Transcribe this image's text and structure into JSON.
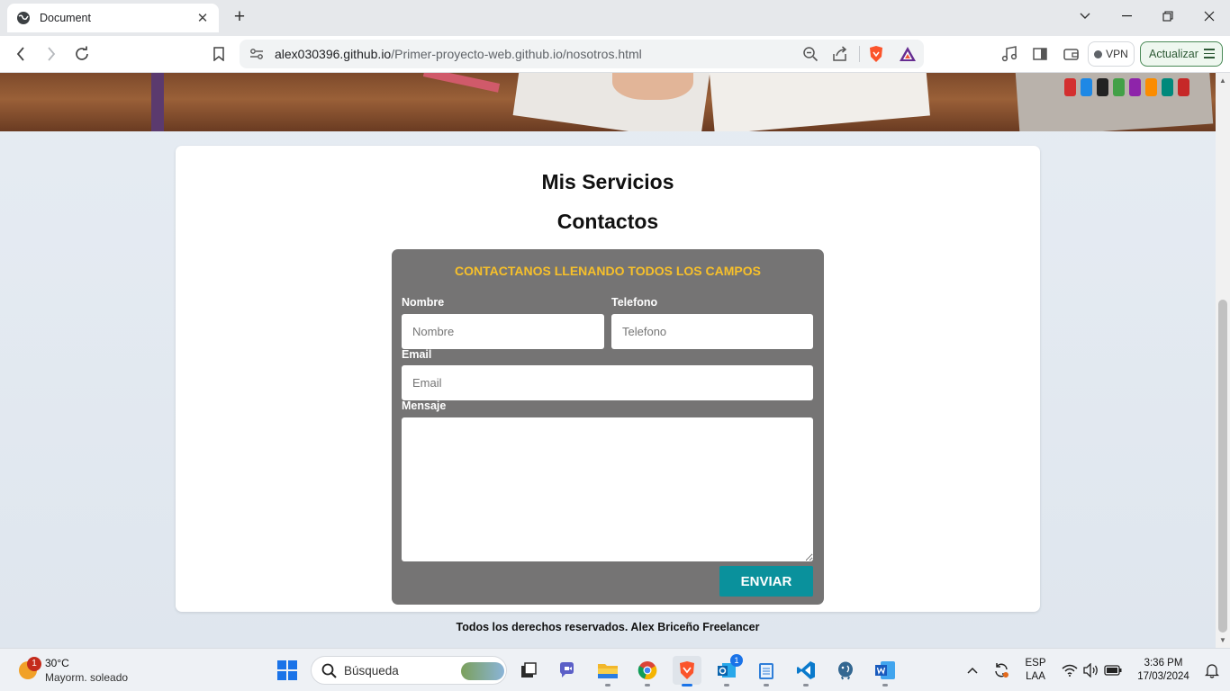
{
  "browser": {
    "tab_title": "Document",
    "url_host": "alex030396.github.io",
    "url_path": "/Primer-proyecto-web.github.io/nosotros.html",
    "vpn_label": "VPN",
    "update_label": "Actualizar"
  },
  "page": {
    "heading_services": "Mis Servicios",
    "heading_contacts": "Contactos",
    "form": {
      "title": "CONTACTANOS LLENANDO TODOS LOS CAMPOS",
      "nombre_label": "Nombre",
      "nombre_placeholder": "Nombre",
      "telefono_label": "Telefono",
      "telefono_placeholder": "Telefono",
      "email_label": "Email",
      "email_placeholder": "Email",
      "mensaje_label": "Mensaje",
      "submit_label": "ENVIAR"
    },
    "footer": "Todos los derechos reservados. Alex Briceño Freelancer"
  },
  "taskbar": {
    "weather_temp": "30°C",
    "weather_desc": "Mayorm. soleado",
    "weather_badge": "1",
    "search_placeholder": "Búsqueda",
    "outlook_badge": "1",
    "lang_top": "ESP",
    "lang_bottom": "LAA",
    "time": "3:36 PM",
    "date": "17/03/2024"
  },
  "colors": {
    "form_background": "#757474",
    "form_title": "#f7c02a",
    "submit_button": "#0a919c"
  }
}
